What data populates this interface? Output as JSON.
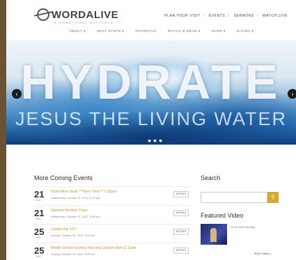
{
  "site": {
    "logo_text": "WORDALIVE",
    "logo_sub": "INTERNATIONAL OUTREACH"
  },
  "top_links": [
    "PLAN YOUR VISIT",
    "EVENTS",
    "SERMONS",
    "WATCH LIVE"
  ],
  "nav": [
    "ABOUT ▾",
    "NEXT STEPS ▾",
    "OUTREACH",
    "WATCH & READ ▾",
    "SHOP ▾",
    "GIVING ▾"
  ],
  "hero": {
    "title": "HYDRATE",
    "subtitle": "JESUS THE LIVING WATER",
    "prev": "‹",
    "next": "›"
  },
  "events": {
    "heading": "More Coming Events",
    "details_label": "DETAILS",
    "items": [
      {
        "day": "21",
        "year": "2021",
        "name": "Word Alive Youth ***New Time*** 6:30pm",
        "date": "Wednesday, October 21, 2021, 6:30 pm"
      },
      {
        "day": "21",
        "year": "2021",
        "name": "Spiritual Warfare Class",
        "date": "Wednesday, October 21, 2021, 6:30 pm"
      },
      {
        "day": "25",
        "year": "2021",
        "name": "Leadership 101",
        "date": "Sunday, October 25, 2021, 9:00 am"
      },
      {
        "day": "25",
        "year": "2021",
        "name": "Middle School Sunday Morning Classes 9am & 11am",
        "date": "Sunday, October 25, 2021, 9:00 am"
      }
    ]
  },
  "sidebar": {
    "search_heading": "Search",
    "search_placeholder": "",
    "search_icon": "magnifier-icon",
    "video_heading": "Featured Video",
    "video_caption": "10-18-2020 Sunday",
    "more_videos": "More Videos ›"
  },
  "colors": {
    "accent": "#d4a92c",
    "event_link": "#c79a2b",
    "frame": "#6b5233"
  }
}
